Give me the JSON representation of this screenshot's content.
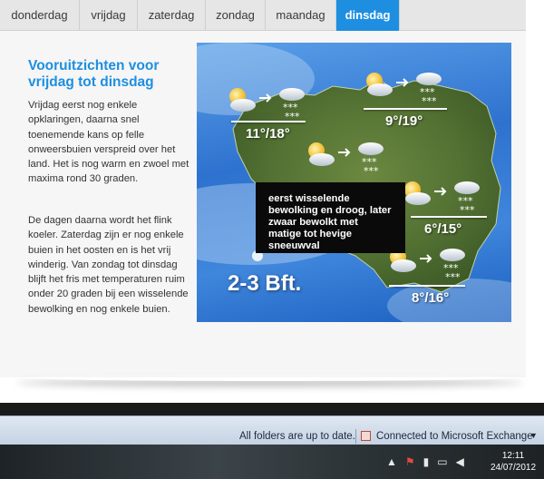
{
  "tabs": [
    {
      "label": "donderdag",
      "active": false
    },
    {
      "label": "vrijdag",
      "active": false
    },
    {
      "label": "zaterdag",
      "active": false
    },
    {
      "label": "zondag",
      "active": false
    },
    {
      "label": "maandag",
      "active": false
    },
    {
      "label": "dinsdag",
      "active": true
    }
  ],
  "headline": "Vooruitzichten voor vrijdag tot dinsdag",
  "paragraph1": "Vrijdag eerst nog enkele opklaringen, daarna snel toenemende kans op felle onweersbuien verspreid over het land. Het is nog warm en zwoel met maxima rond 30 graden.",
  "paragraph2": "De dagen daarna wordt het flink koeler. Zaterdag zijn er nog enkele buien in het oosten en is het vrij winderig. Van zondag tot dinsdag blijft het fris met temperaturen ruim onder 20 graden bij een wisselende bewolking en nog enkele buien.",
  "map": {
    "temps": {
      "west": "11°/18°",
      "north": "9°/19°",
      "east": "6°/15°",
      "south": "8°/16°"
    },
    "wind": "2-3 Bft.",
    "tooltip": "eerst wisselende bewolking en droog, later zwaar bewolkt met matige tot hevige sneeuwval",
    "icons": [
      "partly-cloudy-icon",
      "arrow-right-icon",
      "snow-cloud-icon"
    ]
  },
  "status": {
    "folders": "All folders are up to date.",
    "connection": "Connected to Microsoft Exchange"
  },
  "clock": {
    "time": "12:11",
    "date": "24/07/2012"
  },
  "colors": {
    "accent": "#1e8fe0",
    "headline": "#1d8fe0",
    "tooltip_bg": "#0a0a0a"
  }
}
